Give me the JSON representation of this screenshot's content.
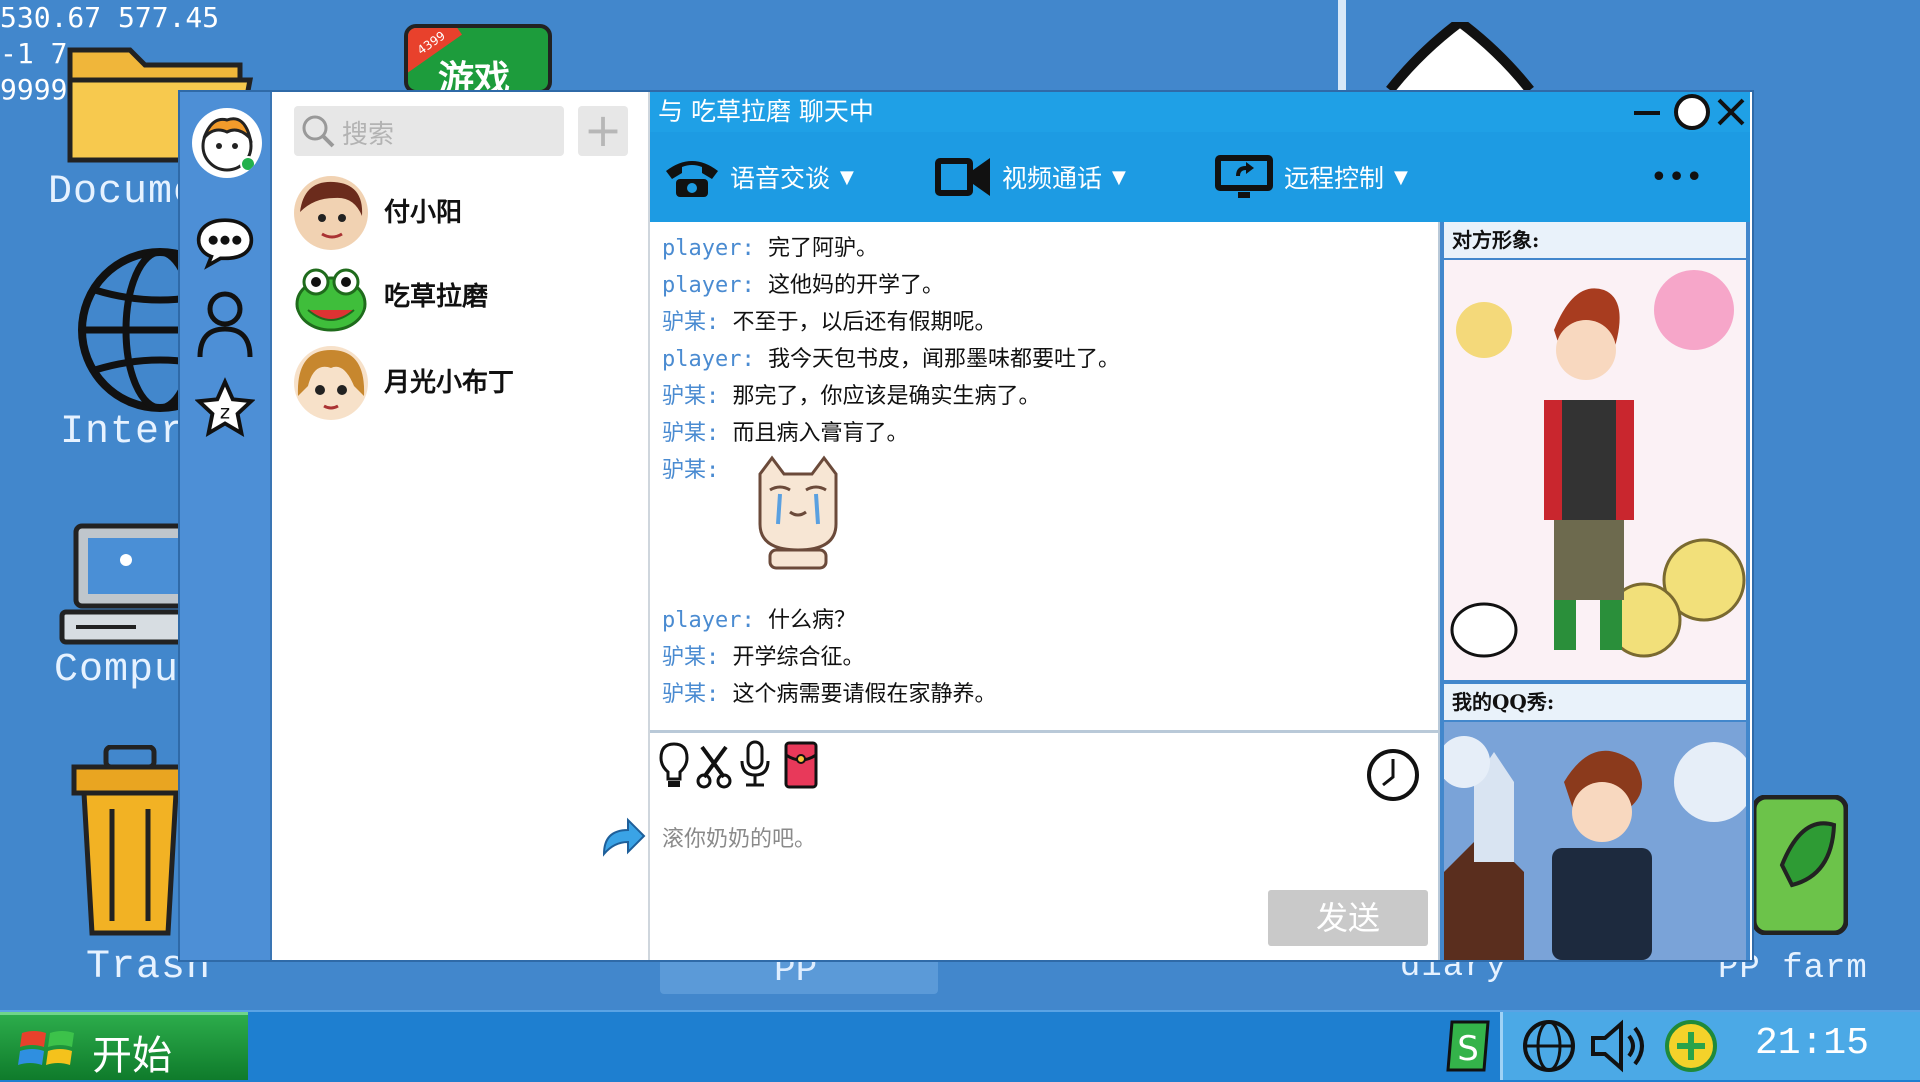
{
  "debug": {
    "line1": "530.67  577.45",
    "line2": "-1    7",
    "line3": "9999"
  },
  "desktop": {
    "icons": [
      "Docume",
      "Inter",
      "Compu",
      "Trash",
      "diary",
      "PP farm"
    ],
    "game_badge": "游戏",
    "game_badge_small": "4399"
  },
  "qq": {
    "search_placeholder": "搜索",
    "add_label": "+",
    "contacts": [
      "付小阳",
      "吃草拉磨",
      "月光小布丁"
    ],
    "title": "与 吃草拉磨 聊天中",
    "tools": [
      {
        "label": "语音交谈",
        "icon": "phone-icon"
      },
      {
        "label": "视频通话",
        "icon": "video-camera-icon"
      },
      {
        "label": "远程控制",
        "icon": "remote-control-icon"
      }
    ],
    "more": "•••",
    "messages": [
      {
        "who": "player",
        "sep": ": ",
        "text": "完了阿驴。"
      },
      {
        "who": "player",
        "sep": ": ",
        "text": "这他妈的开学了。"
      },
      {
        "who": "驴某",
        "sep": ": ",
        "text": "不至于，以后还有假期呢。"
      },
      {
        "who": "player",
        "sep": ": ",
        "text": "我今天包书皮，闻那墨味都要吐了。"
      },
      {
        "who": "驴某",
        "sep": ": ",
        "text": "那完了，你应该是确实生病了。"
      },
      {
        "who": "驴某",
        "sep": ": ",
        "text": "而且病入膏肓了。"
      },
      {
        "who": "驴某",
        "sep": ": ",
        "text": ""
      },
      {
        "who": "player",
        "sep": ": ",
        "text": "什么病？"
      },
      {
        "who": "驴某",
        "sep": ": ",
        "text": "开学综合征。"
      },
      {
        "who": "驴某",
        "sep": ": ",
        "text": "这个病需要请假在家静养。"
      }
    ],
    "input_text": "滚你奶奶的吧。",
    "send_label": "发送",
    "side_header_other": "对方形象:",
    "side_header_mine": "我的QQ秀:"
  },
  "taskbar": {
    "start_label": "开始",
    "pp_label": "PP",
    "clock": "21:15"
  },
  "colors": {
    "desktop": "#4287cc",
    "title": "#1fa0e6",
    "name": "#4a8bd1"
  }
}
